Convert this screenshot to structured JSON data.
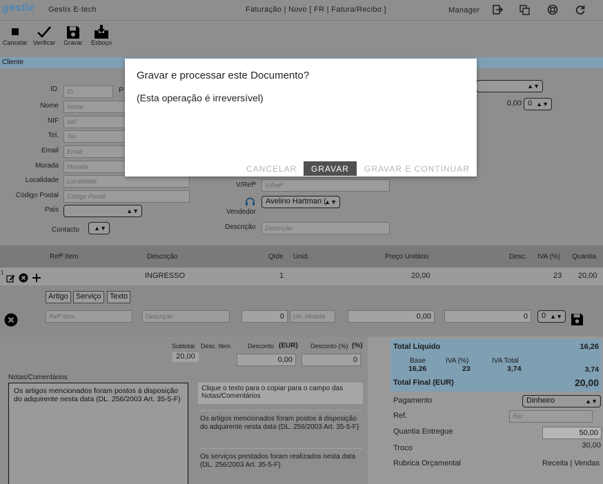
{
  "app": {
    "logo": "gestix",
    "company": "Gestix E-tech",
    "doc_title": "Faturação | Novo [ FR | Fatura/Recibo ]",
    "user": "Manager"
  },
  "toolbar": {
    "cancel": "Cancelar",
    "verify": "Verificar",
    "save": "Gravar",
    "draft": "Esboço"
  },
  "client": {
    "section": "Cliente",
    "id_label": "ID",
    "id_ph": "ID",
    "id_after": "P",
    "name_label": "Nome",
    "name_ph": "Nome",
    "nif_label": "NIF",
    "nif_ph": "NIF",
    "tel_label": "Tel.",
    "tel_ph": "Tel.",
    "email_label": "Email",
    "email_ph": "Email",
    "address_label": "Morada",
    "address_ph": "Morada",
    "city_label": "Localidade",
    "city_ph": "Localidade",
    "zip_label": "Código Postal",
    "zip_ph": "Código Postal",
    "country_label": "País",
    "contact_label": "Contacto"
  },
  "doc": {
    "vref_label": "V/Refª",
    "vref_ph": "V/Refª",
    "seller_label": "Vendedor",
    "seller_value": "Avelino Hartman (",
    "desc_label": "Descrição",
    "desc_ph": "Descrição",
    "discount_value": "0,00",
    "discount_select": "0"
  },
  "items": {
    "headers": {
      "ref": "Refª Item",
      "desc": "Descrição",
      "qty": "Qtde",
      "unit": "Unid.",
      "price": "Preço Unitário",
      "disc": "Desc.",
      "vat": "IVA (%)",
      "amount": "Quantia"
    },
    "rows": [
      {
        "num": "1",
        "desc": "INGRESSO",
        "qty": "1",
        "price": "20,00",
        "vat": "23",
        "amount": "20,00"
      }
    ],
    "buttons": {
      "article": "Artigo",
      "service": "Serviço",
      "text": "Texto"
    },
    "new": {
      "ref_ph": "Refª Item",
      "desc_ph": "Descrição",
      "qty": "0",
      "unit_ph": "Un. Medida",
      "price": "0,00",
      "disc": "0",
      "vat": "0"
    }
  },
  "subtotals": {
    "subtotal_label": "Subtotal",
    "subtotal": "20,00",
    "desc_item_label": "Desc. Item",
    "discount_label": "Desconto",
    "discount_unit": "(EUR)",
    "discount_value": "0,00",
    "discount_pct_label": "Desconto (%)",
    "discount_pct_unit": "(%)",
    "discount_pct_value": "0"
  },
  "notes": {
    "label": "Notas/Comentários",
    "text": "Os artigos mencionados foram postos à disposição do adquirente nesta data (DL. 256/2003 Art. 35-5-F)",
    "hint": "Clique o texto para o copiar para o campo das Notas/Comentários",
    "options": [
      "Os artigos mencionados foram postos à disposição do adquirente nesta data (DL. 256/2003 Art. 35-5-F)",
      "Os serviços prestados foram realizados nesta data (DL. 256/2003 Art. 35-5-F)"
    ]
  },
  "totals": {
    "net_label": "Total Líquido",
    "net": "16,26",
    "base_label": "Base",
    "base": "16,26",
    "vat_pct_label": "IVA (%)",
    "vat_pct": "23",
    "vat_total_label": "IVA Total",
    "vat_total": "3,74",
    "vat_total_right": "3,74",
    "final_label": "Total Final (EUR)",
    "final": "20,00"
  },
  "payment": {
    "label": "Pagamento",
    "method": "Dinheiro",
    "ref_label": "Ref.",
    "ref_ph": "Ref.",
    "given_label": "Quantia Entregue",
    "given": "50,00",
    "change_label": "Troco",
    "change": "30,00",
    "budget_label": "Rubrica Orçamental",
    "budget": "Receita | Vendas"
  },
  "dialog": {
    "title": "Gravar e processar este Documento?",
    "subtitle": "(Esta operação é irreversível)",
    "cancel": "CANCELAR",
    "save": "GRAVAR",
    "save_continue": "GRAVAR E CONTINUAR"
  },
  "colors": {
    "accent_blue": "#7f9fb3",
    "dialog_button": "#505050",
    "logo_blue": "#4d86b8"
  }
}
